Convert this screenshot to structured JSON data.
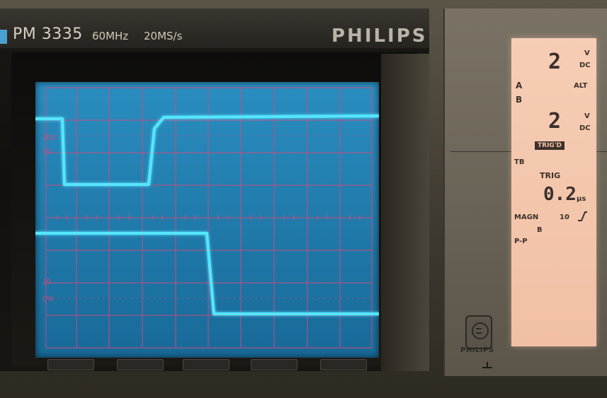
{
  "instrument": {
    "model": "PM 3335",
    "bandwidth": "60MHz",
    "sample_rate": "20MS/s",
    "brand": "PHILIPS"
  },
  "screen": {
    "left_labels": {
      "l100": "100",
      "l90": "90",
      "l10": "10",
      "l0": "0%"
    },
    "colors": {
      "screen_bg": "#1f79a9",
      "grid": "#d04a7f",
      "trace": "#56e6ff"
    }
  },
  "lcd_readout": {
    "a_value": "2",
    "a_unit_v": "V",
    "a_unit_dc": "DC",
    "label_a": "A",
    "label_b": "B",
    "alt": "ALT",
    "b_value": "2",
    "b_unit_v": "V",
    "b_unit_dc": "DC",
    "trigd": "TRIG'D",
    "tb": "TB",
    "trig": "TRIG",
    "time_value": "0.2",
    "time_unit": "µs",
    "magn": "MAGN",
    "magn_value": "10",
    "channel_b": "B",
    "pp": "P-P"
  },
  "panel_bottom": {
    "philips_small": "PHILIPS"
  }
}
